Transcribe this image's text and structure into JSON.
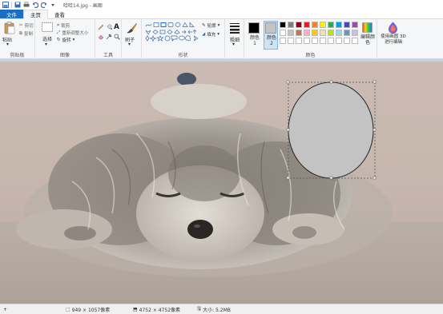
{
  "window": {
    "title": "哈哈14.jpg - 画图"
  },
  "tabs": {
    "file": "文件",
    "home": "主页",
    "view": "查看"
  },
  "ribbon": {
    "clipboard": {
      "paste": "粘贴",
      "cut": "剪切",
      "copy": "复制",
      "label": "剪贴板"
    },
    "image": {
      "select": "选择",
      "crop": "裁剪",
      "resize": "重新调整大小",
      "rotate": "旋转",
      "label": "图像"
    },
    "tools": {
      "label": "工具"
    },
    "brushes": {
      "label": "刷子"
    },
    "shapes": {
      "outline": "轮廓",
      "fill": "填充",
      "label": "形状"
    },
    "size": {
      "label": "粗细"
    },
    "colors": {
      "color1": "颜色 1",
      "color2": "颜色 2",
      "edit": "编辑颜色",
      "paint3d": "使用画图 3D 进行编辑",
      "label": "颜色",
      "palette": [
        "#000000",
        "#7f7f7f",
        "#880015",
        "#ed1c24",
        "#ff7f27",
        "#fff200",
        "#22b14c",
        "#00a2e8",
        "#3f48cc",
        "#a349a4",
        "#ffffff",
        "#c3c3c3",
        "#b97a57",
        "#ffaec9",
        "#ffc90e",
        "#efe4b0",
        "#b5e61d",
        "#99d9ea",
        "#7092be",
        "#c8bfe7"
      ],
      "color1_value": "#000000",
      "color2_value": "#c3c3c3"
    }
  },
  "status": {
    "selection": "949 × 1057像素",
    "image_size": "4752 × 4752像素",
    "file_size": "大小: 5.2MB"
  }
}
